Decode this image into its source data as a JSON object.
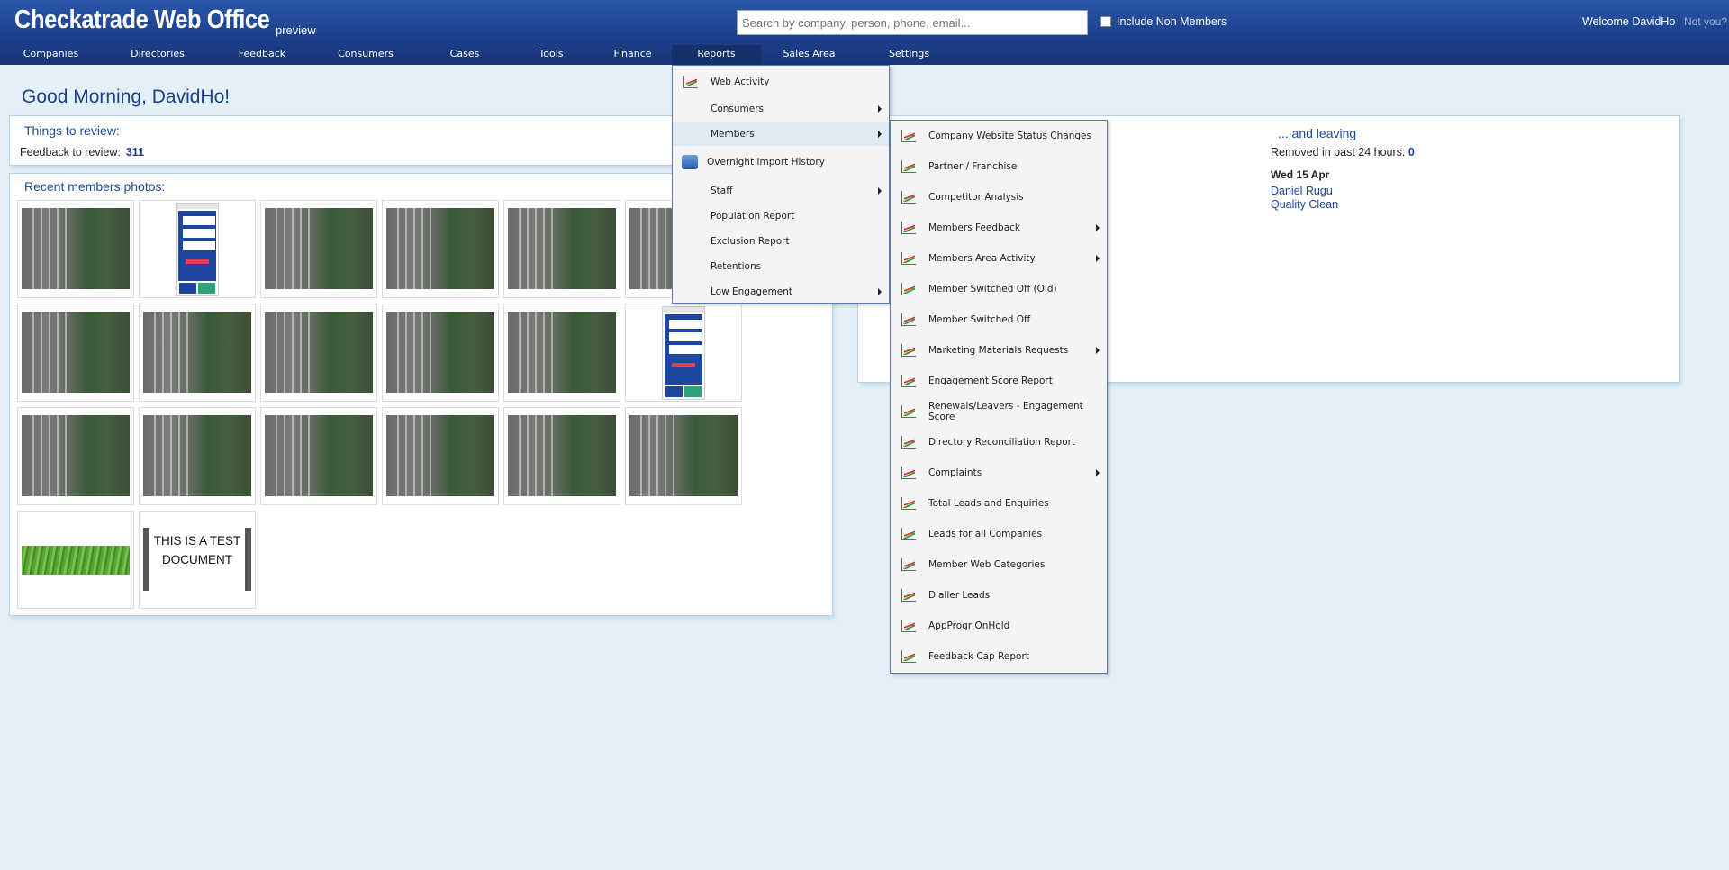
{
  "header": {
    "brand": "Checkatrade Web Office",
    "brand_sub": "preview",
    "search_placeholder": "Search by company, person, phone, email...",
    "include_non_members": "Include Non Members",
    "welcome": "Welcome DavidHo",
    "not_you": "Not you?"
  },
  "nav": {
    "items": [
      "Companies",
      "Directories",
      "Feedback",
      "Consumers",
      "Cases",
      "Tools",
      "Finance",
      "Reports",
      "Sales Area",
      "Settings"
    ],
    "active": "Reports"
  },
  "greeting": "Good Morning, DavidHo!",
  "things": {
    "title": "Things to review:",
    "feedback_label": "Feedback to review:",
    "feedback_value": "311"
  },
  "photos": {
    "title": "Recent members photos:",
    "doc_text": "THIS IS A TEST DOCUMENT"
  },
  "leaving": {
    "title": "... and leaving",
    "removed_label": "Removed in past 24 hours:",
    "removed_value": "0",
    "date": "Wed 15 Apr",
    "links": [
      "Daniel Rugu",
      "Quality Clean"
    ]
  },
  "reports_menu": {
    "items": [
      {
        "label": "Web Activity",
        "icon": "chart-icon",
        "arrow": false
      },
      {
        "label": "Consumers",
        "icon": "",
        "arrow": true
      },
      {
        "label": "Members",
        "icon": "",
        "arrow": true,
        "highlight": true
      },
      {
        "label": "Overnight Import History",
        "icon": "database-icon",
        "arrow": false
      },
      {
        "label": "Staff",
        "icon": "",
        "arrow": true
      },
      {
        "label": "Population Report",
        "icon": "",
        "arrow": false
      },
      {
        "label": "Exclusion Report",
        "icon": "",
        "arrow": false
      },
      {
        "label": "Retentions",
        "icon": "",
        "arrow": false
      },
      {
        "label": "Low Engagement",
        "icon": "",
        "arrow": true
      }
    ]
  },
  "members_menu": {
    "items": [
      {
        "label": "Company Website Status Changes",
        "arrow": false
      },
      {
        "label": "Partner / Franchise",
        "arrow": false
      },
      {
        "label": "Competitor Analysis",
        "arrow": false
      },
      {
        "label": "Members Feedback",
        "arrow": true
      },
      {
        "label": "Members Area Activity",
        "arrow": true
      },
      {
        "label": "Member Switched Off (Old)",
        "arrow": false
      },
      {
        "label": "Member Switched Off",
        "arrow": false
      },
      {
        "label": "Marketing Materials Requests",
        "arrow": true
      },
      {
        "label": "Engagement Score Report",
        "arrow": false
      },
      {
        "label": "Renewals/Leavers - Engagement Score",
        "arrow": false
      },
      {
        "label": "Directory Reconciliation Report",
        "arrow": false
      },
      {
        "label": "Complaints",
        "arrow": true
      },
      {
        "label": "Total Leads and Enquiries",
        "arrow": false
      },
      {
        "label": "Leads for all Companies",
        "arrow": false
      },
      {
        "label": "Member Web Categories",
        "arrow": false
      },
      {
        "label": "Dialler Leads",
        "arrow": false
      },
      {
        "label": "AppProgr OnHold",
        "arrow": false
      },
      {
        "label": "Feedback Cap Report",
        "arrow": false
      }
    ]
  }
}
